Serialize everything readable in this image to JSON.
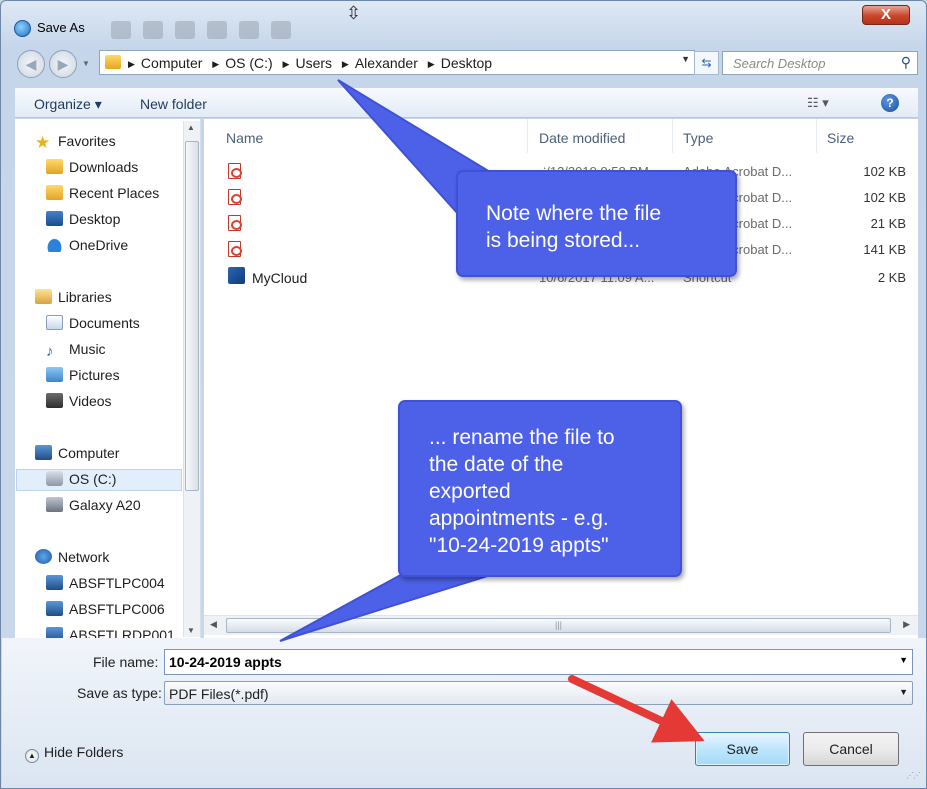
{
  "window": {
    "title": "Save As",
    "close_label": "X"
  },
  "address_bar": {
    "crumbs": [
      "Computer",
      "OS (C:)",
      "Users",
      "Alexander",
      "Desktop"
    ],
    "search_placeholder": "Search Desktop"
  },
  "command_bar": {
    "organize_label": "Organize ▾",
    "new_folder_label": "New folder"
  },
  "nav_pane": {
    "favorites": {
      "label": "Favorites",
      "items": [
        "Downloads",
        "Recent Places",
        "Desktop",
        "OneDrive"
      ]
    },
    "libraries": {
      "label": "Libraries",
      "items": [
        "Documents",
        "Music",
        "Pictures",
        "Videos"
      ]
    },
    "computer": {
      "label": "Computer",
      "items": [
        "OS (C:)",
        "Galaxy A20"
      ]
    },
    "network": {
      "label": "Network",
      "items": [
        "ABSFTLPC004",
        "ABSFTLPC006",
        "ABSFTLRDP001"
      ]
    }
  },
  "file_list": {
    "columns": {
      "name": "Name",
      "date": "Date modified",
      "type": "Type",
      "size": "Size"
    },
    "rows": [
      {
        "name": "",
        "date": "6/13/2019 9:58 PM",
        "type": "Adobe Acrobat D...",
        "size": "102 KB"
      },
      {
        "name": "",
        "date": "",
        "type": "Adobe Acrobat D...",
        "size": "102 KB"
      },
      {
        "name": "",
        "date": "",
        "type": "Adobe Acrobat D...",
        "size": "21 KB"
      },
      {
        "name": "",
        "date": "",
        "type": "Adobe Acrobat D...",
        "size": "141 KB"
      },
      {
        "name": "MyCloud",
        "date": "10/6/2017 11:09 A...",
        "type": "Shortcut",
        "size": "2 KB"
      }
    ]
  },
  "form": {
    "file_name_label": "File name:",
    "file_name_value": "10-24-2019 appts",
    "save_type_label": "Save as type:",
    "save_type_value": "PDF Files(*.pdf)",
    "hide_folders_label": "Hide Folders",
    "save_label": "Save",
    "cancel_label": "Cancel"
  },
  "callouts": {
    "storage_note": [
      "Note where the file",
      "is being stored..."
    ],
    "rename_note": [
      "... rename the file to",
      "the date of the",
      "exported",
      "appointments - e.g.",
      "\"10-24-2019 appts\""
    ]
  },
  "colors": {
    "callout_fill": "#4d61e8",
    "arrow_red": "#e53935",
    "save_button": "#bee6fd"
  }
}
